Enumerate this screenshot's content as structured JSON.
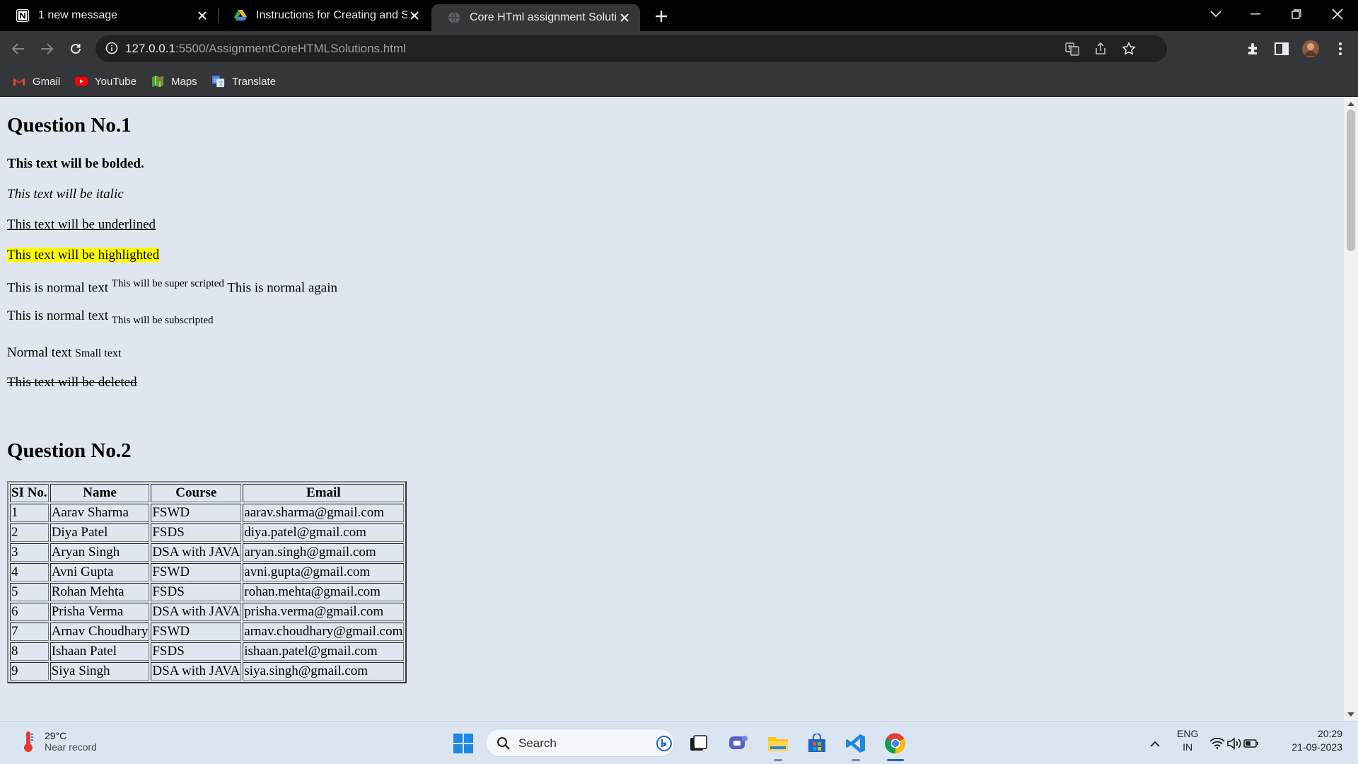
{
  "browser": {
    "tabs": [
      {
        "title": "1 new message",
        "icon": "notion-icon"
      },
      {
        "title": "Instructions for Creating and Sub",
        "icon": "google-drive-icon"
      },
      {
        "title": "Core HTml assignment Solutions",
        "icon": "globe-icon",
        "active": true
      }
    ],
    "url": {
      "host": "127.0.0.1",
      "rest": ":5500/AssignmentCoreHTMLSolutions.html"
    },
    "bookmarks": [
      {
        "label": "Gmail",
        "icon": "gmail-icon"
      },
      {
        "label": "YouTube",
        "icon": "youtube-icon"
      },
      {
        "label": "Maps",
        "icon": "maps-icon"
      },
      {
        "label": "Translate",
        "icon": "translate-icon"
      }
    ]
  },
  "page": {
    "q1": {
      "heading": "Question No.1",
      "bold": "This text will be bolded.",
      "italic": "This text will be italic",
      "underline": "This text will be underlined",
      "highlight": "This text will be highlighted",
      "sup_before": "This is normal text",
      "sup_text": "This will be super scripted",
      "sup_after": "This is normal again",
      "sub_before": "This is normal text",
      "sub_text": "This will be subscripted",
      "small_before": "Normal text",
      "small_text": "Small text",
      "deleted": "This text will be deleted"
    },
    "q2": {
      "heading": "Question No.2",
      "columns": [
        "SI No.",
        "Name",
        "Course",
        "Email"
      ],
      "rows": [
        [
          "1",
          "Aarav Sharma",
          "FSWD",
          "aarav.sharma@gmail.com"
        ],
        [
          "2",
          "Diya Patel",
          "FSDS",
          "diya.patel@gmail.com"
        ],
        [
          "3",
          "Aryan Singh",
          "DSA with JAVA",
          "aryan.singh@gmail.com"
        ],
        [
          "4",
          "Avni Gupta",
          "FSWD",
          "avni.gupta@gmail.com"
        ],
        [
          "5",
          "Rohan Mehta",
          "FSDS",
          "rohan.mehta@gmail.com"
        ],
        [
          "6",
          "Prisha Verma",
          "DSA with JAVA",
          "prisha.verma@gmail.com"
        ],
        [
          "7",
          "Arnav Choudhary",
          "FSWD",
          "arnav.choudhary@gmail.com"
        ],
        [
          "8",
          "Ishaan Patel",
          "FSDS",
          "ishaan.patel@gmail.com"
        ],
        [
          "9",
          "Siya Singh",
          "DSA with JAVA",
          "siya.singh@gmail.com"
        ]
      ]
    }
  },
  "taskbar": {
    "weather": {
      "temp": "29°C",
      "desc": "Near record"
    },
    "search_label": "Search",
    "lang": {
      "line1": "ENG",
      "line2": "IN"
    },
    "clock": {
      "time": "20:29",
      "date": "21-09-2023"
    }
  },
  "colors": {
    "highlight": "#ffff00",
    "page_bg": "#dfe6ef",
    "tab_strip": "#000000",
    "toolbar": "#35363a"
  }
}
